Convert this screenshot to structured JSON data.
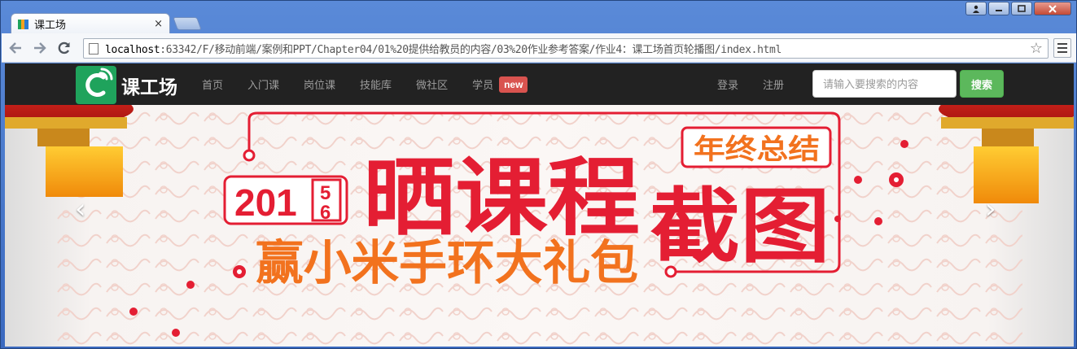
{
  "browser": {
    "tab_title": "课工场",
    "tab_close": "×",
    "url_host": "localhost",
    "url_rest": ":63342/F/移动前端/案例和PPT/Chapter04/01%20提供给教员的内容/03%20作业参考答案/作业4：课工场首页轮播图/index.html",
    "star_glyph": "☆",
    "window_buttons": [
      "▟",
      "—",
      "▢",
      "✕"
    ]
  },
  "site": {
    "logo_text": "课工场",
    "nav": {
      "home": "首页",
      "intro": "入门课",
      "post": "岗位课",
      "skills": "技能库",
      "community": "微社区",
      "student": "学员",
      "new_badge": "new"
    },
    "login": "登录",
    "register": "注册",
    "search_placeholder": "请输入要搜索的内容",
    "search_button": "搜索"
  },
  "carousel": {
    "year_prefix": "201",
    "year_digit_top": "5",
    "year_digit_bottom": "6",
    "headline": "晒课程",
    "headline_2": "截图",
    "ribbon": "年终总结",
    "subline": "赢小米手环大礼包",
    "prev_glyph": "‹",
    "next_glyph": "›"
  },
  "colors": {
    "navbar": "#222222",
    "logo_green": "#1fa35c",
    "badge_red": "#d9534f",
    "search_green": "#5cb85c",
    "headline_red": "#e41e33",
    "subline_orange": "#f2721e"
  }
}
